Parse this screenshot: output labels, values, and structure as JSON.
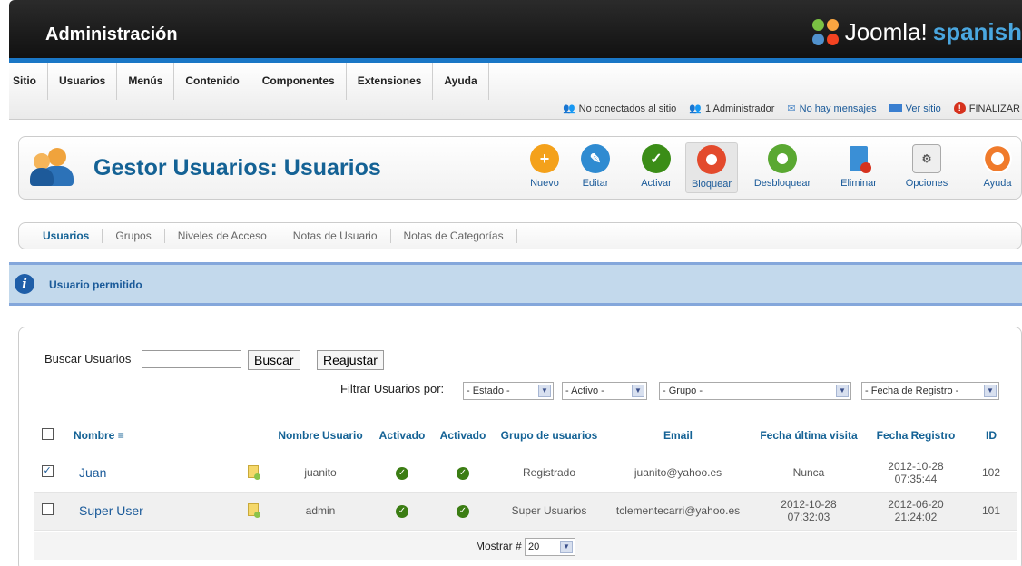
{
  "header": {
    "title": "Administración",
    "logo_text": "Joomla!",
    "logo_accent": "spanish"
  },
  "menu": [
    "Sitio",
    "Usuarios",
    "Menús",
    "Contenido",
    "Componentes",
    "Extensiones",
    "Ayuda"
  ],
  "status": {
    "offline": "No conectados al sitio",
    "admins": "1 Administrador",
    "messages": "No hay mensajes",
    "view_site": "Ver sitio",
    "logout": "FINALIZAR"
  },
  "page": {
    "title": "Gestor Usuarios: Usuarios"
  },
  "toolbar": [
    {
      "label": "Nuevo",
      "icon": "plus-icon",
      "color": "#f4a11b"
    },
    {
      "label": "Editar",
      "icon": "pencil-icon",
      "color": "#2f8bd1"
    },
    {
      "label": "Activar",
      "icon": "check-icon",
      "color": "#3b8d17"
    },
    {
      "label": "Bloquear",
      "icon": "block-icon",
      "color": "#e34a2c"
    },
    {
      "label": "Desbloquear",
      "icon": "unblock-icon",
      "color": "#5aa832"
    },
    {
      "label": "Eliminar",
      "icon": "trash-icon",
      "color": "#3a8fd6"
    },
    {
      "label": "Opciones",
      "icon": "options-icon",
      "color": "#bfbfbf"
    },
    {
      "label": "Ayuda",
      "icon": "help-icon",
      "color": "#f07b2c"
    }
  ],
  "submenu": [
    "Usuarios",
    "Grupos",
    "Niveles de Acceso",
    "Notas de Usuario",
    "Notas de Categorías"
  ],
  "message": "Usuario permitido",
  "search": {
    "label": "Buscar Usuarios",
    "value": "",
    "search_btn": "Buscar",
    "reset_btn": "Reajustar"
  },
  "filters": {
    "label": "Filtrar Usuarios por:",
    "state": "- Estado -",
    "active": "- Activo -",
    "group": "- Grupo -",
    "date": "- Fecha de Registro -"
  },
  "table": {
    "headers": [
      "Nombre",
      "Nombre Usuario",
      "Activado",
      "Activado",
      "Grupo de usuarios",
      "Email",
      "Fecha última visita",
      "Fecha Registro",
      "ID"
    ],
    "rows": [
      {
        "name": "Juan",
        "username": "juanito",
        "group": "Registrado",
        "email": "juanito@yahoo.es",
        "last_visit_1": "Nunca",
        "last_visit_2": "",
        "reg_1": "2012-10-28",
        "reg_2": "07:35:44",
        "id": "102",
        "checked": true
      },
      {
        "name": "Super User",
        "username": "admin",
        "group": "Super Usuarios",
        "email": "tclementecarri@yahoo.es",
        "last_visit_1": "2012-10-28",
        "last_visit_2": "07:32:03",
        "reg_1": "2012-06-20",
        "reg_2": "21:24:02",
        "id": "101",
        "checked": false
      }
    ]
  },
  "pagination": {
    "label": "Mostrar #",
    "value": "20"
  }
}
